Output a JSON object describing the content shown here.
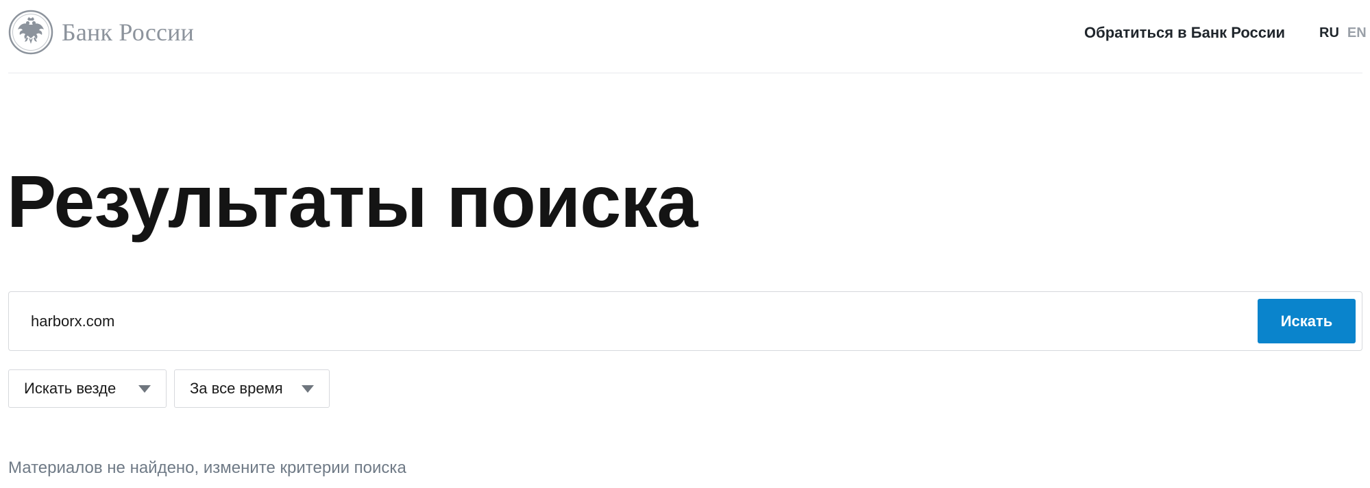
{
  "header": {
    "logo_text": "Банк России",
    "logo_icon": "double-headed-eagle-emblem",
    "contact_link": "Обратиться в Банк России",
    "languages": {
      "ru": "RU",
      "en": "EN",
      "active": "RU"
    }
  },
  "main": {
    "title": "Результаты поиска",
    "search": {
      "value": "harborx.com",
      "button_label": "Искать"
    },
    "filters": {
      "where": {
        "label": "Искать везде",
        "icon": "caret-down-icon"
      },
      "time": {
        "label": "За все время",
        "icon": "caret-down-icon"
      }
    },
    "empty_message": "Материалов не найдено, измените критерии поиска"
  },
  "colors": {
    "accent": "#0a84cc",
    "logo_gray": "#8c939c",
    "muted_text": "#6f7a86",
    "border": "#d6d8dc"
  }
}
